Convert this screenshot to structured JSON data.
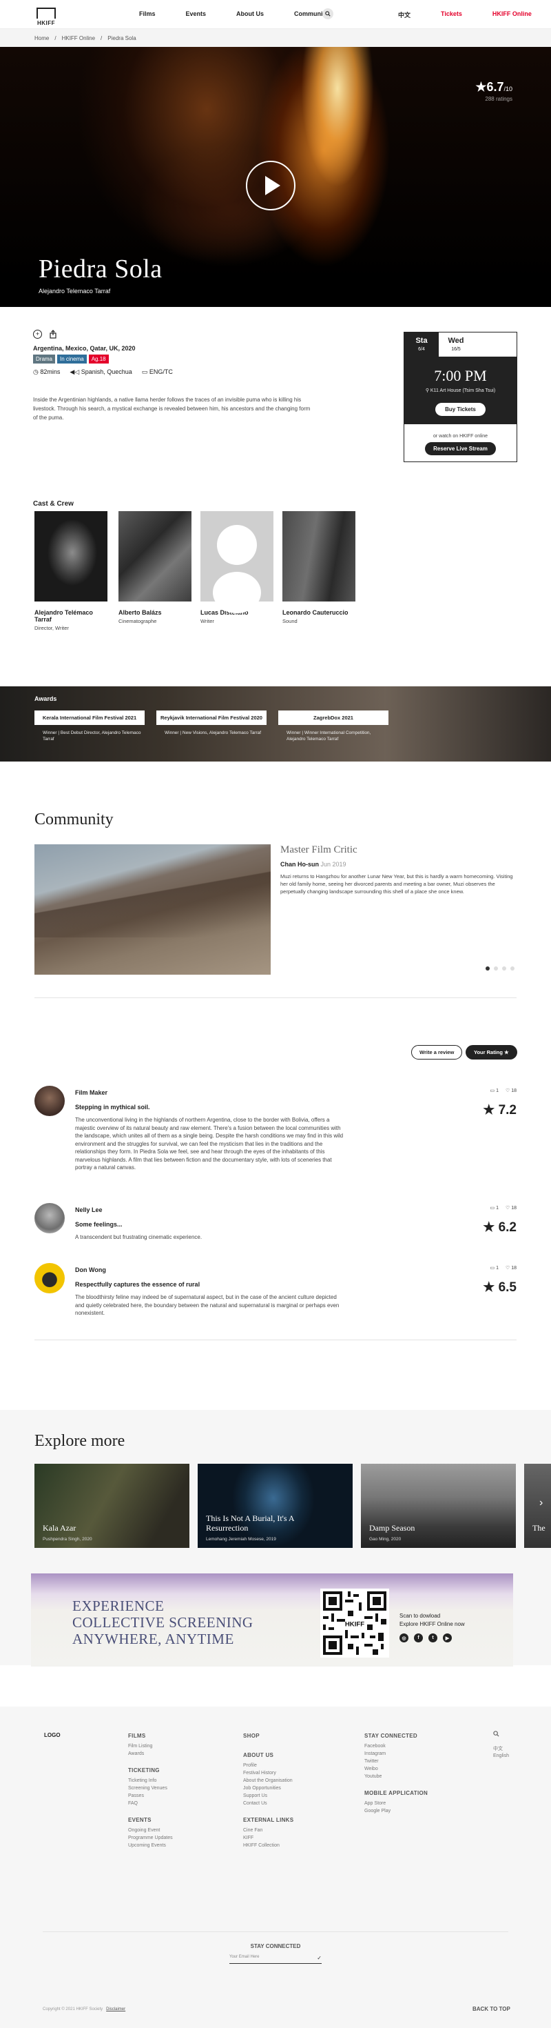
{
  "header": {
    "logo_text": "HKIFF",
    "menu": [
      "Films",
      "Events",
      "About Us",
      "Community"
    ],
    "lang": "中文",
    "tickets": "Tickets",
    "online": "HKIFF Online"
  },
  "breadcrumb": [
    "Home",
    "HKIFF Online",
    "Piedra Sola"
  ],
  "hero": {
    "rating": "6.7",
    "rating_scale": "/10",
    "rating_count": "288 ratings",
    "title": "Piedra Sola",
    "director": "Alejandro Telemaco Tarraf"
  },
  "film": {
    "countries": "Argentina, Mexico, Qatar, UK, 2020",
    "tags": [
      {
        "label": "Drama",
        "color": "#5f7681"
      },
      {
        "label": "In cinema",
        "color": "#2f6e9a"
      },
      {
        "label": "Ag.18",
        "color": "#e4002b"
      }
    ],
    "duration": "82mins",
    "language": "Spanish, Quechua",
    "subtitles": "ENG/TC",
    "synopsis": "Inside the Argentinian highlands, a native llama herder follows the traces of an invisible puma who is killing his livestock. Through his search, a mystical exchange is revealed between him, his ancestors and the changing form of the puma."
  },
  "schedule": {
    "days": [
      {
        "day": "Sta",
        "date": "6/4"
      },
      {
        "day": "Wed",
        "date": "16/5"
      }
    ],
    "time": "7:00 PM",
    "venue": "K11 Art House (Tsim Sha Tsui)",
    "tickets_label": "Buy Tickets",
    "or_watch": "or watch on HKIFF online",
    "live_label": "Reserve Live Stream"
  },
  "cast": {
    "title": "Cast & Crew",
    "people": [
      {
        "name": "Alejandro Telémaco Tarraf",
        "role": "Director, Writer"
      },
      {
        "name": "Alberto Balázs",
        "role": "Cinematographe"
      },
      {
        "name": "Lucas Distéfano",
        "role": "Writer"
      },
      {
        "name": "Leonardo Cauteruccio",
        "role": "Sound"
      }
    ]
  },
  "awards": {
    "title": "Awards",
    "items": [
      {
        "festival": "Kerala International Film Festival 2021",
        "text": "Winner  |  Best Debut Director, Alejandro Telemaco Tarraf"
      },
      {
        "festival": "Reykjavik International Film Festival 2020",
        "text": "Winner  |  New Visions, Alejandro Telemaco Tarraf"
      },
      {
        "festival": "ZagrebDox 2021",
        "text": "Winner  |  Winner International Competition, Alejandro Telemaco Tarraf"
      }
    ]
  },
  "community": {
    "title": "Community",
    "critic_label": "Master Film Critic",
    "author": "Chan Ho-sun",
    "date": "Jun 2019",
    "text": "Muzi returns to Hangzhou for another Lunar New Year, but this is hardly a warm homecoming. Visiting her old family home, seeing her divorced parents and meeting a bar owner, Muzi observes the perpetually changing landscape surrounding this shell of a place she once knew.",
    "write_review": "Write a review",
    "your_rating": "Your Rating"
  },
  "reviews": [
    {
      "name": "Film Maker",
      "headline": "Stepping in mythical soil.",
      "body": "The unconventional living in the highlands of northern Argentina, close to the border with Bolivia, offers a majestic overview of its natural beauty and raw element. There's a fusion between the local communities with the landscape, which unites all of them as a single being. Despite the harsh conditions we may find in this wild environment and the struggles for survival, we can feel the mysticism that lies in the traditions and the relationships they form. In Piedra Sola we feel, see and hear through the eyes of the inhabitants of this marvelous highlands. A film that lies between fiction and the documentary style, with lots of sceneries that portray a natural canvas.",
      "comments": "1",
      "likes": "18",
      "score": "7.2"
    },
    {
      "name": "Nelly Lee",
      "headline": "Some feelings...",
      "body": "A transcendent but frustrating cinematic experience.",
      "comments": "1",
      "likes": "18",
      "score": "6.2"
    },
    {
      "name": "Don Wong",
      "headline": "Respectfully captures the essence of rural",
      "body": "The bloodthirsty feline may indeed be of supernatural aspect, but in the case of the ancient culture depicted and quietly celebrated here, the boundary between the natural and supernatural is marginal or perhaps even nonexistent.",
      "comments": "1",
      "likes": "18",
      "score": "6.5"
    }
  ],
  "explore": {
    "title": "Explore more",
    "cards": [
      {
        "title": "Kala Azar",
        "sub": "Pushpendra Singh, 2020"
      },
      {
        "title": "This Is Not A Burial, It's A Resurrection",
        "sub": "Lemohang Jeremiah Mosese, 2019"
      },
      {
        "title": "Damp Season",
        "sub": "Gao Ming, 2020"
      },
      {
        "title": "The",
        "sub": ""
      }
    ]
  },
  "promo": {
    "line1": "EXPERIENCE",
    "line2": "COLLECTIVE SCREENING",
    "line3": "ANYWHERE, ANYTIME",
    "scan1": "Scan to dowload",
    "scan2": "Explore HKIFF Online now"
  },
  "footer": {
    "logo": "LOGO",
    "films_h": "FILMS",
    "films": [
      "Film Listing",
      "Awards"
    ],
    "ticketing_h": "TICKETING",
    "ticketing": [
      "Ticketing Info",
      "Screening Venues",
      "Passes",
      "FAQ"
    ],
    "events_h": "EVENTS",
    "events": [
      "Ongoing Event",
      "Programme Updates",
      "Upcoming Events"
    ],
    "shop_h": "SHOP",
    "about_h": "ABOUT US",
    "about": [
      "Profile",
      "Festival History",
      "About the Organisation",
      "Job Opportunities",
      "Support Us",
      "Contact Us"
    ],
    "external_h": "EXTERNAL LINKS",
    "external": [
      "Cine Fan",
      "KIFF",
      "HKIFF Collection"
    ],
    "connected_h": "STAY CONNECTED",
    "connected": [
      "Facebook",
      "Instagram",
      "Twitter",
      "Weibo",
      "Youtube"
    ],
    "mobile_h": "MOBILE APPLICATION",
    "mobile": [
      "App Store",
      "Google Play"
    ],
    "lang1": "中文",
    "lang2": "English",
    "stay": "STAY CONNECTED",
    "email_placeholder": "Your Email Here",
    "copyright": "Copyright © 2021 HKIFF Society",
    "disclaimer": "Disclaimer",
    "back_top": "BACK TO TOP"
  }
}
